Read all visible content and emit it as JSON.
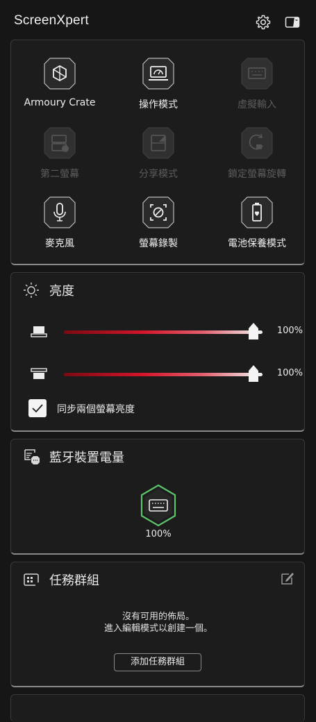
{
  "app": {
    "title": "ScreenXpert"
  },
  "header": {
    "settings_icon": "gear-icon",
    "panel_icon": "side-panel-icon"
  },
  "quick_actions": [
    {
      "label": "Armoury Crate",
      "icon": "armoury-crate-icon",
      "enabled": true
    },
    {
      "label": "操作模式",
      "icon": "operation-mode-icon",
      "enabled": true
    },
    {
      "label": "虛擬輸入",
      "icon": "virtual-keyboard-icon",
      "enabled": false
    },
    {
      "label": "第二螢幕",
      "icon": "second-screen-icon",
      "enabled": false
    },
    {
      "label": "分享模式",
      "icon": "share-mode-icon",
      "enabled": false
    },
    {
      "label": "鎖定螢幕旋轉",
      "icon": "rotation-lock-icon",
      "enabled": false
    },
    {
      "label": "麥克風",
      "icon": "microphone-icon",
      "enabled": true
    },
    {
      "label": "螢幕錄製",
      "icon": "screen-record-icon",
      "enabled": true
    },
    {
      "label": "電池保養模式",
      "icon": "battery-care-icon",
      "enabled": true
    }
  ],
  "brightness": {
    "title": "亮度",
    "icon": "sun-icon",
    "main_display": {
      "value": 1.0,
      "label": "100%",
      "icon": "laptop-main-display-icon"
    },
    "second_display": {
      "value": 1.0,
      "label": "100%",
      "icon": "laptop-second-display-icon"
    },
    "sync_label": "同步兩個螢幕亮度",
    "sync_checked": true
  },
  "bluetooth": {
    "title": "藍牙裝置電量",
    "icon": "bluetooth-device-icon",
    "device_icon": "keyboard-icon",
    "battery": 1.0,
    "battery_label": "100%",
    "accent": "#5ec46a"
  },
  "task_group": {
    "title": "任務群組",
    "icon": "task-group-icon",
    "edit_icon": "edit-icon",
    "empty_line1": "沒有可用的佈局。",
    "empty_line2": "進入編輯模式以創建一個。",
    "add_button": "添加任務群組"
  }
}
